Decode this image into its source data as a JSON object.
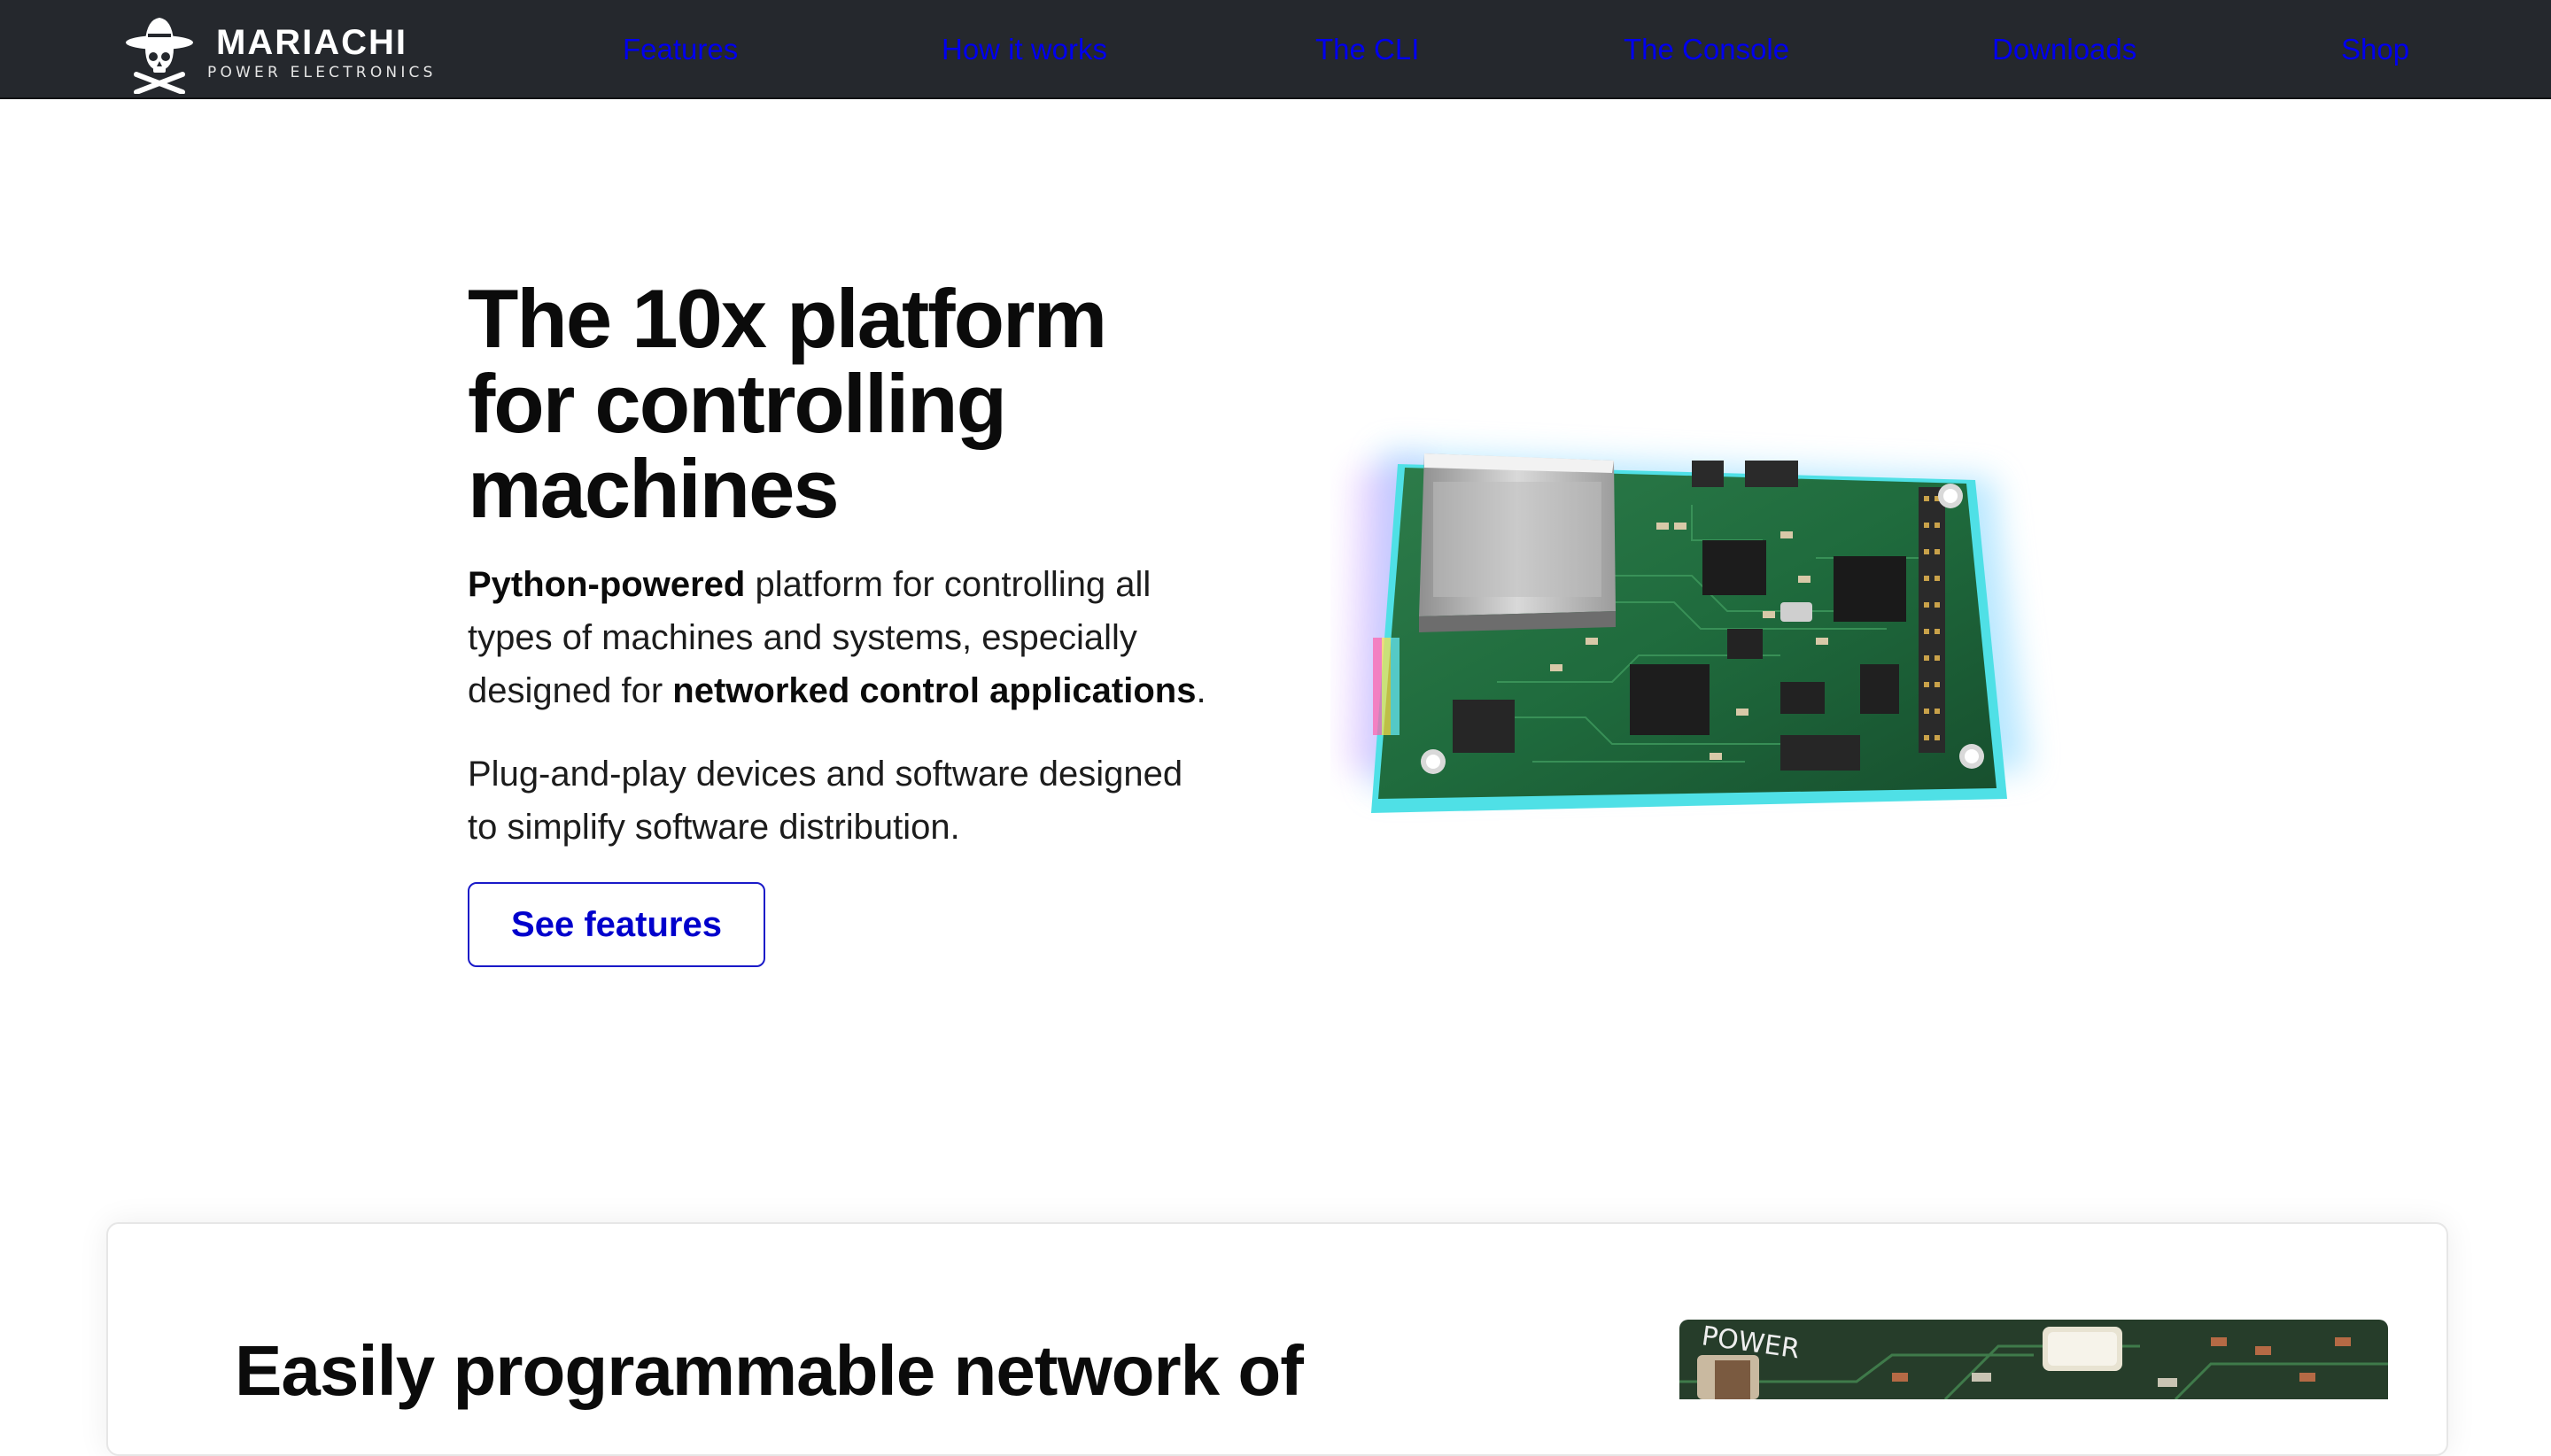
{
  "brand": {
    "name": "MARIACHI",
    "tagline": "POWER ELECTRONICS"
  },
  "nav": {
    "items": [
      {
        "label": "Features"
      },
      {
        "label": "How it works"
      },
      {
        "label": "The CLI"
      },
      {
        "label": "The Console"
      },
      {
        "label": "Downloads"
      },
      {
        "label": "Shop"
      }
    ]
  },
  "hero": {
    "title": "The 10x platform for controlling machines",
    "desc_bold_1": "Python-powered",
    "desc_text_1": " platform for controlling all types of machines and systems, especially designed for ",
    "desc_bold_2": "networked control applications",
    "desc_text_2": ".",
    "desc2": "Plug-and-play devices and software designed to simplify software distribution.",
    "cta_label": "See features"
  },
  "features_card": {
    "title": "Easily programmable network of",
    "image_label": "POWER"
  },
  "colors": {
    "nav_bg": "#25282d",
    "link": "#0000ee",
    "cta_border": "#1a1ac8",
    "pcb_green": "#1f6b3d"
  }
}
